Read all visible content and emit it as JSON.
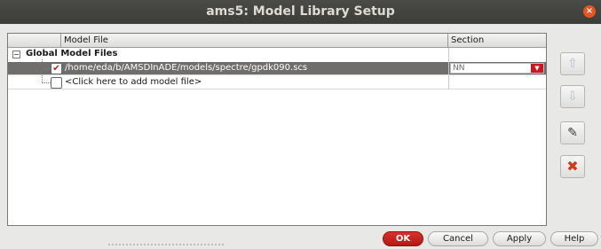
{
  "window": {
    "title": "ams5: Model Library Setup",
    "close_glyph": "×"
  },
  "table": {
    "columns": [
      "",
      "Model File",
      "Section"
    ],
    "group": {
      "expander": "−",
      "label": "Global Model Files"
    },
    "rows": [
      {
        "checked": true,
        "check_glyph": "✔",
        "model_file": "/home/eda/b/AMSDInADE/models/spectre/gpdk090.scs",
        "section": "NN",
        "selected": true
      },
      {
        "checked": false,
        "check_glyph": "",
        "model_file": "<Click here to add model file>",
        "section": "",
        "selected": false
      }
    ]
  },
  "side_buttons": [
    {
      "name": "move-up",
      "icon": "arrow-up-icon",
      "glyph": "⇧",
      "enabled": false
    },
    {
      "name": "move-down",
      "icon": "arrow-down-icon",
      "glyph": "⇩",
      "enabled": false
    },
    {
      "name": "edit",
      "icon": "edit-icon",
      "glyph": "✎",
      "enabled": true
    },
    {
      "name": "delete",
      "icon": "delete-icon",
      "glyph": "✖",
      "enabled": true
    }
  ],
  "buttons": {
    "ok": "OK",
    "cancel": "Cancel",
    "apply": "Apply",
    "help": "Help"
  },
  "colors": {
    "accent": "#c8171f",
    "selection": "#6f6e6c",
    "titlebar": "#3c3c39"
  }
}
